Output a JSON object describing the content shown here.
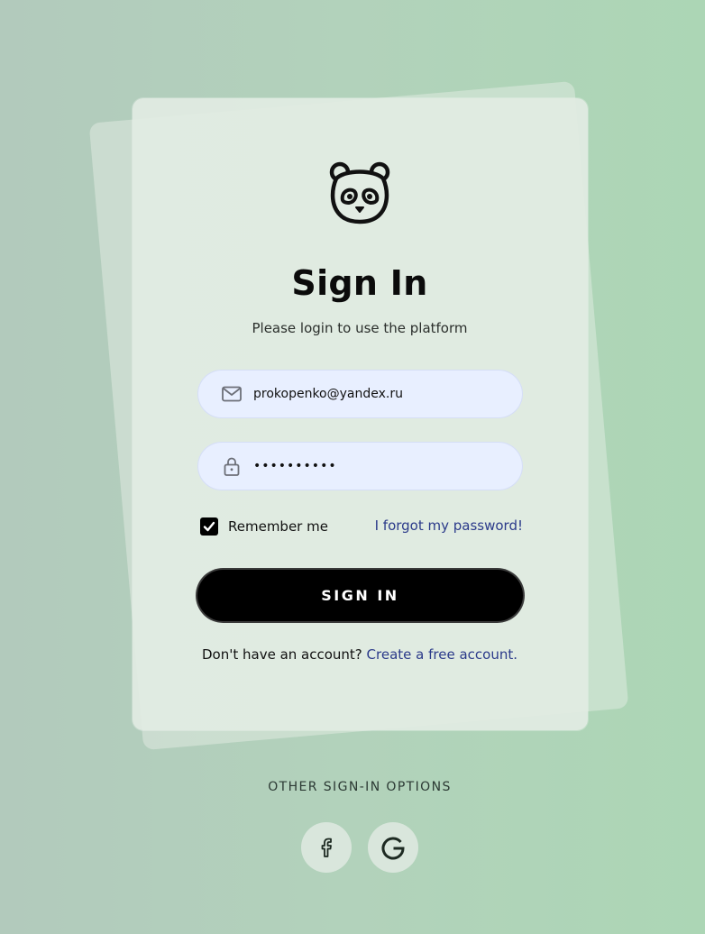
{
  "card": {
    "title": "Sign In",
    "subtitle": "Please login to use the platform"
  },
  "email": {
    "value": "prokopenko@yandex.ru",
    "icon": "mail-icon"
  },
  "password": {
    "value": "••••••••••",
    "icon": "lock-icon"
  },
  "remember": {
    "label": "Remember me",
    "checked": true
  },
  "forgot": {
    "label": "I forgot my password!"
  },
  "signin": {
    "label": "SIGN IN"
  },
  "signup": {
    "prompt": "Don't have an account?",
    "link": "Create a free account."
  },
  "other": {
    "label": "OTHER SIGN-IN OPTIONS",
    "providers": [
      "facebook-icon",
      "google-icon"
    ]
  },
  "colors": {
    "link": "#2b3a8a",
    "button": "#000000",
    "field_bg": "#e8efff"
  }
}
